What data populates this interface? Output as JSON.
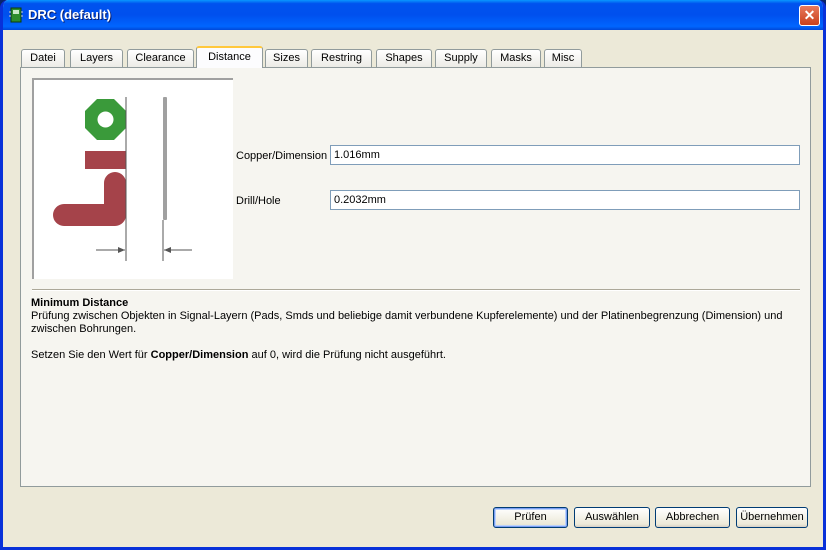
{
  "window": {
    "title": "DRC (default)",
    "close_label": "✕"
  },
  "tabs": [
    {
      "label": "Datei"
    },
    {
      "label": "Layers"
    },
    {
      "label": "Clearance"
    },
    {
      "label": "Distance",
      "active": true
    },
    {
      "label": "Sizes"
    },
    {
      "label": "Restring"
    },
    {
      "label": "Shapes"
    },
    {
      "label": "Supply"
    },
    {
      "label": "Masks"
    },
    {
      "label": "Misc"
    }
  ],
  "fields": {
    "copper_dimension": {
      "label": "Copper/Dimension",
      "value": "1.016mm"
    },
    "drill_hole": {
      "label": "Drill/Hole",
      "value": "0.2032mm"
    }
  },
  "description": {
    "title": "Minimum Distance",
    "body": "Prüfung zwischen Objekten in Signal-Layern (Pads, Smds und beliebige damit verbundene Kupferelemente) und der Platinenbegrenzung (Dimension) und zwischen Bohrungen.",
    "note_prefix": "Setzen Sie den Wert für ",
    "note_bold": "Copper/Dimension",
    "note_suffix": " auf 0, wird die Prüfung nicht ausgeführt."
  },
  "buttons": {
    "check": "Prüfen",
    "select": "Auswählen",
    "cancel": "Abbrechen",
    "apply": "Übernehmen"
  },
  "colors": {
    "pad_green": "#3a9a3a",
    "copper_red": "#a5434a",
    "dimension_gray": "#a0a0a0"
  }
}
